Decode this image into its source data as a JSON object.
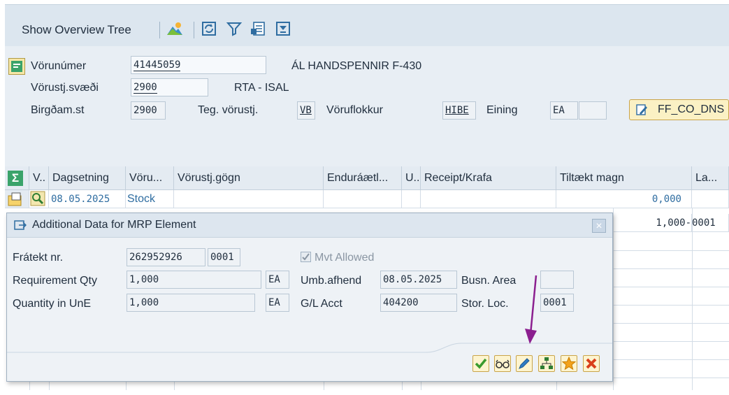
{
  "toolbar": {
    "show_overview_tree": "Show Overview Tree",
    "icons": [
      "mountain-icon",
      "refresh-icon",
      "filter-icon",
      "export-icon",
      "print-icon"
    ]
  },
  "header": {
    "material_label": "Vörunúmer",
    "material_value": "41445059",
    "material_desc": "ÁL HANDSPENNIR F-430",
    "plant_label": "Vörustj.svæði",
    "plant_value": "2900",
    "plant_desc": "RTA - ISAL",
    "storage_label": "Birgðam.st",
    "storage_value": "2900",
    "mrp_type_label": "Teg. vörustj.",
    "mrp_type_value": "VB",
    "group_label": "Vöruflokkur",
    "group_value": "HIBE",
    "unit_label": "Eining",
    "unit_value": "EA",
    "ff_button": "FF_CO_DNS"
  },
  "grid": {
    "columns": [
      "V..",
      "Dagsetning",
      "Vöru...",
      "Vörustj.gögn",
      "Enduráætl...",
      "U..",
      "Receipt/Krafa",
      "Tiltækt magn",
      "La..."
    ],
    "rows": [
      {
        "date": "08.05.2025",
        "element": "Stock",
        "available": "0,000",
        "last": ""
      },
      {
        "date": "",
        "element": "",
        "available": "1,000-",
        "last": "0001"
      }
    ]
  },
  "dialog": {
    "title": "Additional Data for MRP Element",
    "close": "×",
    "reservation_label": "Frátekt nr.",
    "reservation_value": "262952926",
    "reservation_item": "0001",
    "mvt_allowed_label": "Mvt Allowed",
    "mvt_allowed_checked": true,
    "req_qty_label": "Requirement Qty",
    "req_qty_value": "1,000",
    "req_qty_unit": "EA",
    "qty_une_label": "Quantity in UnE",
    "qty_une_value": "1,000",
    "qty_une_unit": "EA",
    "umb_label": "Umb.afhend",
    "umb_value": "08.05.2025",
    "busn_area_label": "Busn. Area",
    "busn_area_value": "",
    "gl_label": "G/L Acct",
    "gl_value": "404200",
    "stor_loc_label": "Stor. Loc.",
    "stor_loc_value": "0001",
    "buttons": [
      "check-icon",
      "glasses-icon",
      "pencil-icon",
      "hierarchy-icon",
      "star-icon",
      "cancel-icon"
    ]
  },
  "annotation": {
    "arrow_color": "#8b1f8f"
  }
}
